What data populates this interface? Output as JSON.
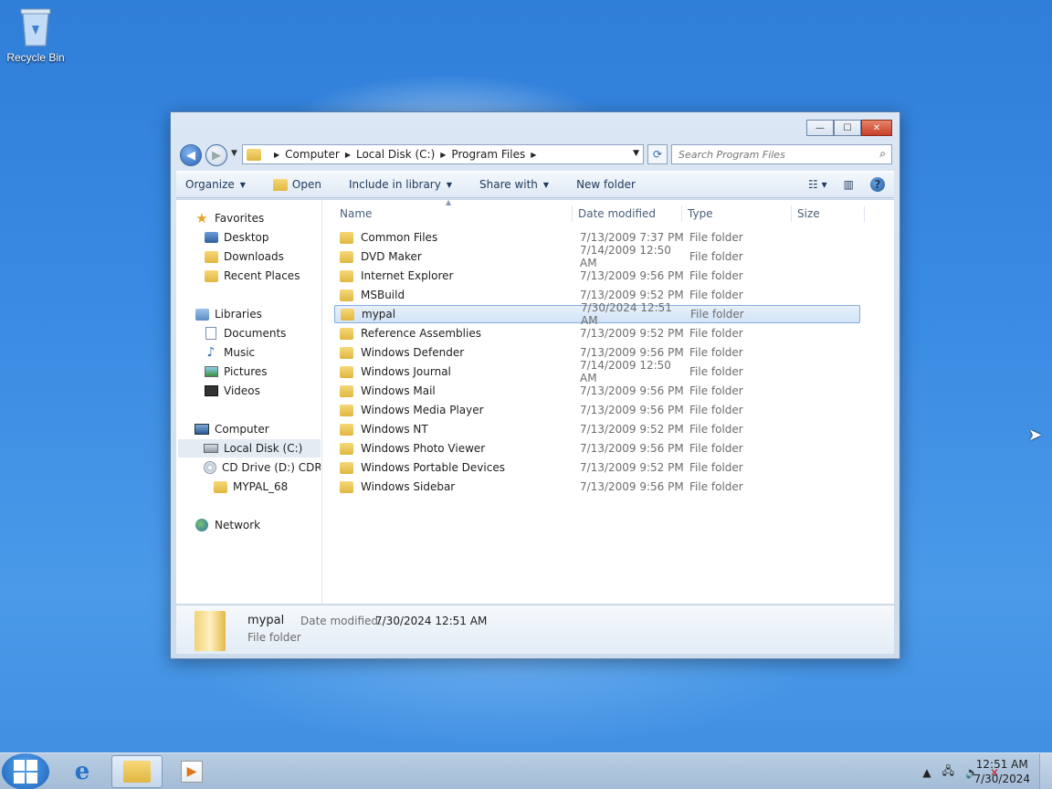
{
  "desktop": {
    "recycle_bin_label": "Recycle Bin"
  },
  "window": {
    "caption_buttons": {
      "minimize": "—",
      "maximize": "☐",
      "close": "✕"
    },
    "address": {
      "crumbs": [
        "Computer",
        "Local Disk (C:)",
        "Program Files"
      ]
    },
    "search": {
      "placeholder": "Search Program Files"
    },
    "toolbar": {
      "organize": "Organize",
      "open": "Open",
      "include_in_library": "Include in library",
      "share_with": "Share with",
      "new_folder": "New folder"
    },
    "navpane": {
      "favorites": "Favorites",
      "desktop": "Desktop",
      "downloads": "Downloads",
      "recent_places": "Recent Places",
      "libraries": "Libraries",
      "documents": "Documents",
      "music": "Music",
      "pictures": "Pictures",
      "videos": "Videos",
      "computer": "Computer",
      "local_disk": "Local Disk (C:)",
      "cd_drive": "CD Drive (D:) CDROI",
      "mypal_68": "MYPAL_68",
      "network": "Network"
    },
    "columns": {
      "name": "Name",
      "date_modified": "Date modified",
      "type": "Type",
      "size": "Size"
    },
    "files": [
      {
        "name": "Common Files",
        "date": "7/13/2009 7:37 PM",
        "type": "File folder"
      },
      {
        "name": "DVD Maker",
        "date": "7/14/2009 12:50 AM",
        "type": "File folder"
      },
      {
        "name": "Internet Explorer",
        "date": "7/13/2009 9:56 PM",
        "type": "File folder"
      },
      {
        "name": "MSBuild",
        "date": "7/13/2009 9:52 PM",
        "type": "File folder"
      },
      {
        "name": "mypal",
        "date": "7/30/2024 12:51 AM",
        "type": "File folder"
      },
      {
        "name": "Reference Assemblies",
        "date": "7/13/2009 9:52 PM",
        "type": "File folder"
      },
      {
        "name": "Windows Defender",
        "date": "7/13/2009 9:56 PM",
        "type": "File folder"
      },
      {
        "name": "Windows Journal",
        "date": "7/14/2009 12:50 AM",
        "type": "File folder"
      },
      {
        "name": "Windows Mail",
        "date": "7/13/2009 9:56 PM",
        "type": "File folder"
      },
      {
        "name": "Windows Media Player",
        "date": "7/13/2009 9:56 PM",
        "type": "File folder"
      },
      {
        "name": "Windows NT",
        "date": "7/13/2009 9:52 PM",
        "type": "File folder"
      },
      {
        "name": "Windows Photo Viewer",
        "date": "7/13/2009 9:56 PM",
        "type": "File folder"
      },
      {
        "name": "Windows Portable Devices",
        "date": "7/13/2009 9:52 PM",
        "type": "File folder"
      },
      {
        "name": "Windows Sidebar",
        "date": "7/13/2009 9:56 PM",
        "type": "File folder"
      }
    ],
    "selected_file": "mypal",
    "details": {
      "name": "mypal",
      "type": "File folder",
      "modified_label": "Date modified:",
      "modified_value": "7/30/2024 12:51 AM"
    }
  },
  "taskbar": {
    "clock_time": "12:51 AM",
    "clock_date": "7/30/2024"
  },
  "colors": {
    "desktop_bg": "#3a8be3",
    "selection_border": "#84acdd",
    "taskbar": "#a4bcd6"
  }
}
